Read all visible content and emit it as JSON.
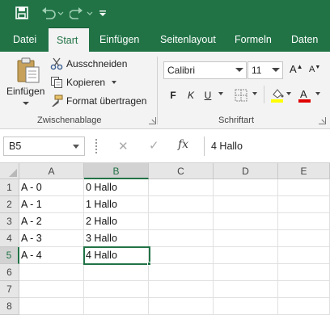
{
  "colors": {
    "accent": "#217346",
    "ribbon_bg": "#f3f3f3",
    "highlight_yellow": "#ffff00",
    "font_red": "#e00000"
  },
  "quick_access": [
    {
      "name": "save-icon"
    },
    {
      "name": "undo-icon"
    },
    {
      "name": "redo-icon"
    },
    {
      "name": "customize-toolbar-icon"
    }
  ],
  "tabs": [
    "Datei",
    "Start",
    "Einfügen",
    "Seitenlayout",
    "Formeln",
    "Daten"
  ],
  "active_tab": "Start",
  "clipboard": {
    "paste_label": "Einfügen",
    "cut_label": "Ausschneiden",
    "copy_label": "Kopieren",
    "format_painter_label": "Format übertragen",
    "group_label": "Zwischenablage"
  },
  "font": {
    "family": "Calibri",
    "size": "11",
    "bold": "F",
    "italic": "K",
    "underline": "U",
    "group_label": "Schriftart"
  },
  "formula_bar": {
    "name_box": "B5",
    "fx": "fx",
    "content": "4 Hallo"
  },
  "sheet": {
    "columns": [
      "A",
      "B",
      "C",
      "D",
      "E"
    ],
    "selected_column": "B",
    "selected_row": 5,
    "rows": [
      {
        "num": "1",
        "cells": [
          "A - 0",
          "0 Hallo",
          "",
          "",
          ""
        ]
      },
      {
        "num": "2",
        "cells": [
          "A - 1",
          "1 Hallo",
          "",
          "",
          ""
        ]
      },
      {
        "num": "3",
        "cells": [
          "A - 2",
          "2 Hallo",
          "",
          "",
          ""
        ]
      },
      {
        "num": "4",
        "cells": [
          "A - 3",
          "3 Hallo",
          "",
          "",
          ""
        ]
      },
      {
        "num": "5",
        "cells": [
          "A - 4",
          "4 Hallo",
          "",
          "",
          ""
        ]
      },
      {
        "num": "6",
        "cells": [
          "",
          "",
          "",
          "",
          ""
        ]
      },
      {
        "num": "7",
        "cells": [
          "",
          "",
          "",
          "",
          ""
        ]
      },
      {
        "num": "8",
        "cells": [
          "",
          "",
          "",
          "",
          ""
        ]
      }
    ]
  }
}
